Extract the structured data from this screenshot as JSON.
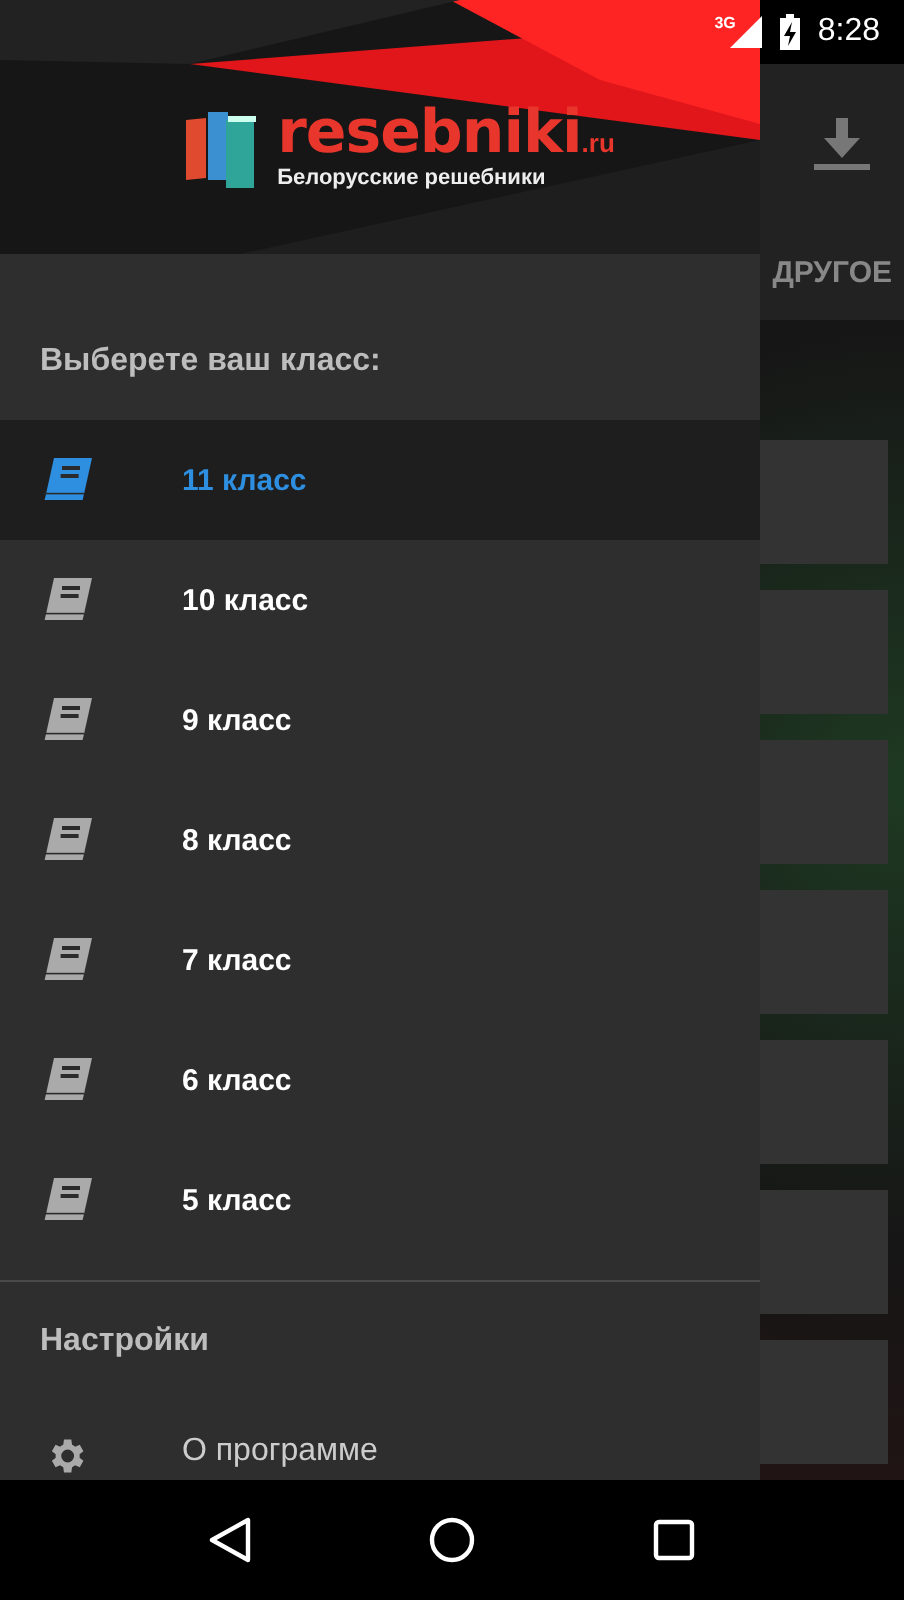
{
  "status_bar": {
    "network": "3G",
    "time": "8:28"
  },
  "visible_tab": "ДРУГОЕ",
  "drawer": {
    "logo": {
      "name": "resebniki",
      "domain": ".ru",
      "tagline": "Белорусские решебники"
    },
    "heading": "Выберете ваш класс:",
    "classes": [
      {
        "label": "11 класс",
        "selected": true
      },
      {
        "label": "10 класс",
        "selected": false
      },
      {
        "label": "9 класс",
        "selected": false
      },
      {
        "label": "8 класс",
        "selected": false
      },
      {
        "label": "7 класс",
        "selected": false
      },
      {
        "label": "6 класс",
        "selected": false
      },
      {
        "label": "5 класс",
        "selected": false
      }
    ],
    "settings_heading": "Настройки",
    "settings_items": [
      {
        "label": "О программе"
      }
    ]
  }
}
